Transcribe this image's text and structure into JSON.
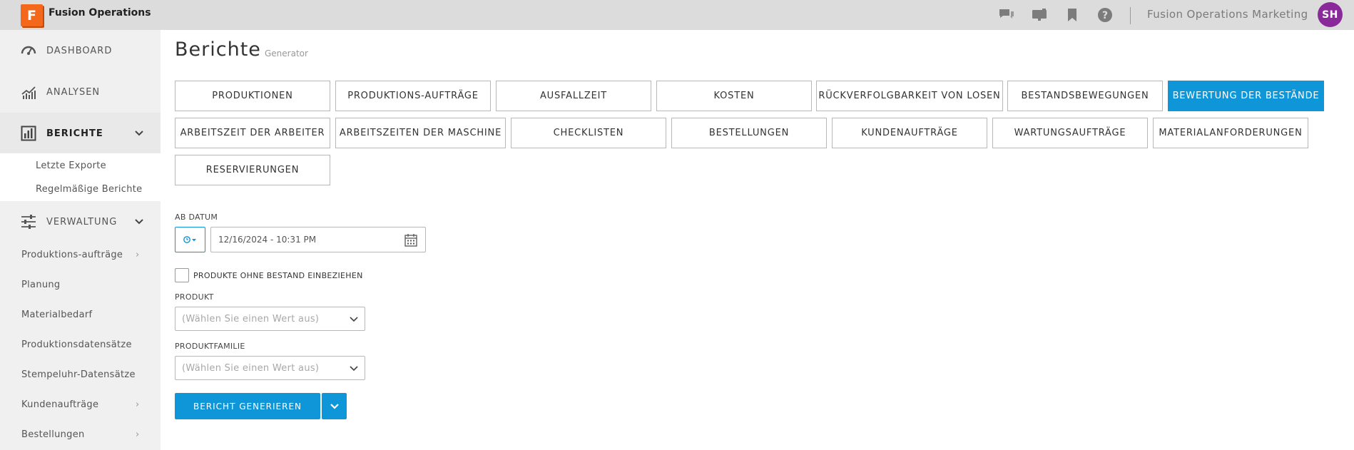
{
  "topbar": {
    "app_logo_letter": "F",
    "app_title": "Fusion Operations",
    "icons": [
      "chat-icon",
      "presentation-icon",
      "bookmark-icon",
      "help-icon"
    ],
    "org_name": "Fusion Operations Marketing",
    "avatar_initials": "SH",
    "avatar_color": "#8a2a9a"
  },
  "sidebar": {
    "main_items": [
      {
        "label": "DASHBOARD",
        "icon": "speedometer-icon"
      },
      {
        "label": "ANALYSEN",
        "icon": "analytics-chart-icon"
      },
      {
        "label": "BERICHTE",
        "icon": "report-bar-icon",
        "active": true
      },
      {
        "label": "VERWALTUNG",
        "icon": "sliders-icon"
      }
    ],
    "reports_subitems": [
      "Letzte Exporte",
      "Regelmäßige Berichte"
    ],
    "admin_subitems": [
      {
        "label": "Produktions-aufträge",
        "has_children": true
      },
      {
        "label": "Planung",
        "has_children": false
      },
      {
        "label": "Materialbedarf",
        "has_children": false
      },
      {
        "label": "Produktionsdatensätze",
        "has_children": false
      },
      {
        "label": "Stempeluhr-Datensätze",
        "has_children": false
      },
      {
        "label": "Kundenaufträge",
        "has_children": true
      },
      {
        "label": "Bestellungen",
        "has_children": true
      }
    ]
  },
  "main": {
    "title": "Berichte",
    "subtitle": "Generator",
    "report_types": [
      "PRODUKTIONEN",
      "PRODUKTIONS-AUFTRÄGE",
      "AUSFALLZEIT",
      "KOSTEN",
      "RÜCKVERFOLGBARKEIT VON LOSEN",
      "BESTANDSBEWEGUNGEN",
      "BEWERTUNG DER BESTÄNDE",
      "ARBEITSZEIT DER ARBEITER",
      "ARBEITSZEITEN DER MASCHINE",
      "CHECKLISTEN",
      "BESTELLUNGEN",
      "KUNDENAUFTRÄGE",
      "WARTUNGSAUFTRÄGE",
      "MATERIALANFORDERUNGEN",
      "RESERVIERUNGEN"
    ],
    "active_report": "BEWERTUNG DER BESTÄNDE",
    "form": {
      "date_label": "AB DATUM",
      "date_value": "12/16/2024 - 10:31 PM",
      "include_no_stock_label": "PRODUKTE OHNE BESTAND EINBEZIEHEN",
      "include_no_stock_checked": false,
      "product_label": "PRODUKT",
      "product_placeholder": "(Wählen Sie einen Wert aus)",
      "family_label": "PRODUKTFAMILIE",
      "family_placeholder": "(Wählen Sie einen Wert aus)",
      "generate_label": "BERICHT GENERIEREN"
    }
  },
  "colors": {
    "accent": "#0f96d9",
    "topbar_bg": "#dcdcdc",
    "sidebar_bg": "#f0f0f0",
    "logo": "#f4681b"
  }
}
